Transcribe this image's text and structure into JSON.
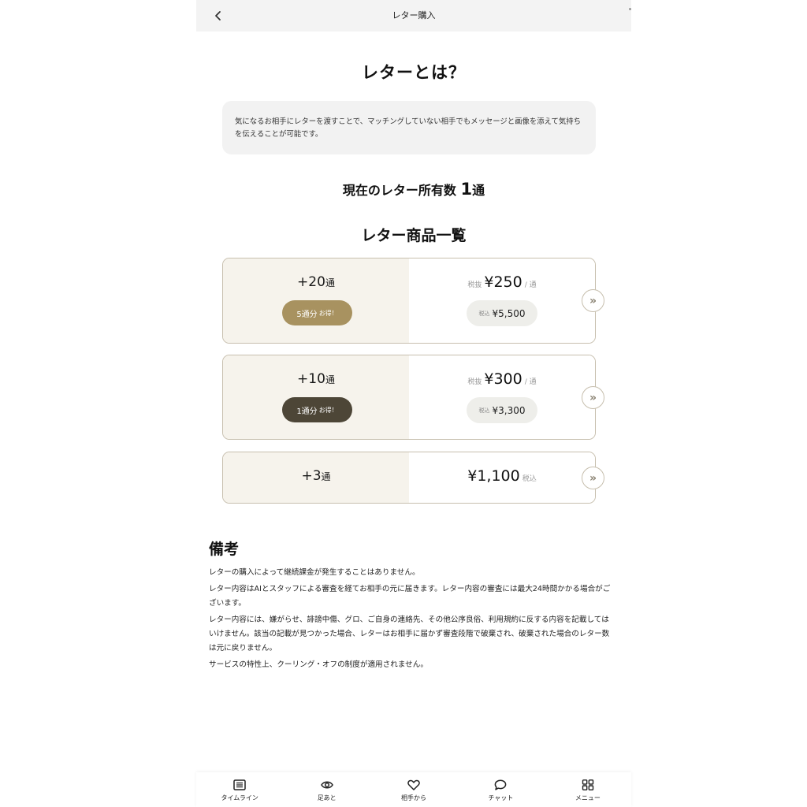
{
  "header": {
    "title": "レター購入"
  },
  "intro": {
    "title": "レターとは？",
    "description": "気になるお相手にレターを渡すことで、マッチングしていない相手でもメッセージと画像を添えて気持ちを伝えることが可能です。"
  },
  "owned": {
    "label": "現在のレター所有数",
    "count": "1",
    "unit": "通"
  },
  "products_title": "レター商品一覧",
  "products": [
    {
      "qty": "+20",
      "unit": "通",
      "badge": "5通分",
      "badge_suffix": "お得！",
      "price_tag": "税抜",
      "price": "¥250",
      "per": "/ 通",
      "tax_tag": "税込",
      "tax_price": "¥5,500"
    },
    {
      "qty": "+10",
      "unit": "通",
      "badge": "1通分",
      "badge_suffix": "お得！",
      "price_tag": "税抜",
      "price": "¥300",
      "per": "/ 通",
      "tax_tag": "税込",
      "tax_price": "¥3,300"
    },
    {
      "qty": "+3",
      "unit": "通",
      "price": "¥1,100",
      "price_suffix": "税込"
    }
  ],
  "notes": {
    "title": "備考",
    "items": [
      "レターの購入によって継続課金が発生することはありません。",
      "レター内容はAIとスタッフによる審査を経てお相手の元に届きます。レター内容の審査には最大24時間かかる場合がございます。",
      "レター内容には、嫌がらせ、誹謗中傷、グロ、ご自身の連絡先、その他公序良俗、利用規約に反する内容を記載してはいけません。該当の記載が見つかった場合、レターはお相手に届かず審査段階で破棄され、破棄された場合のレター数は元に戻りません。",
      "サービスの特性上、クーリング・オフの制度が適用されません。"
    ]
  },
  "nav": [
    {
      "label": "タイムライン",
      "icon": "list-icon"
    },
    {
      "label": "足あと",
      "icon": "eye-icon"
    },
    {
      "label": "相手から",
      "icon": "heart-icon"
    },
    {
      "label": "チャット",
      "icon": "chat-icon"
    },
    {
      "label": "メニュー",
      "icon": "grid-icon"
    }
  ],
  "colors": {
    "gold": "#a89260",
    "dark": "#4d4637",
    "card_border": "#c7bfae",
    "card_left_bg": "#f6f3ec"
  }
}
